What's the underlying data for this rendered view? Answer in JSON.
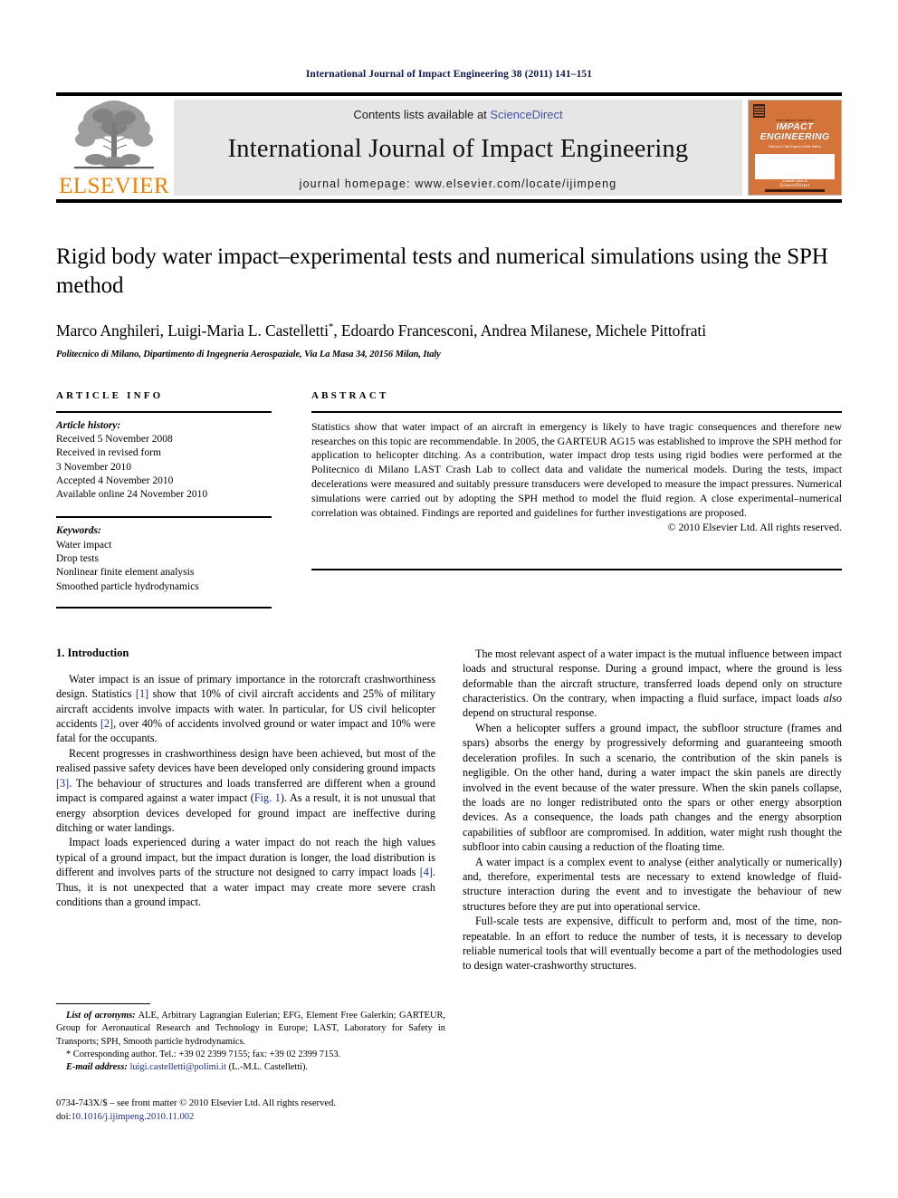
{
  "running_head": "International Journal of Impact Engineering 38 (2011) 141–151",
  "masthead": {
    "publisher_name": "ELSEVIER",
    "contents_prefix": "Contents lists available at ",
    "sciencedirect": "ScienceDirect",
    "journal_title": "International Journal of Impact Engineering",
    "homepage": "journal homepage: www.elsevier.com/locate/ijimpeng",
    "cover": {
      "small_top": "International Journal of",
      "title_line1": "IMPACT",
      "title_line2": "ENGINEERING",
      "editors": "Editors-in-Chief\nEugenio Oñate Ibáñez",
      "bottom_small": "available online at",
      "bottom_brand": "ScienceDirect"
    },
    "accent_orange": "#ef8200",
    "link_blue": "#4156a6",
    "banner_gray": "#e6e6e6"
  },
  "article": {
    "title": "Rigid body water impact–experimental tests and numerical simulations using the SPH method",
    "authors": "Marco Anghileri, Luigi-Maria L. Castelletti",
    "authors_star": "*",
    "authors_rest": ", Edoardo Francesconi, Andrea Milanese, Michele Pittofrati",
    "affiliation": "Politecnico di Milano, Dipartimento di Ingegneria Aerospaziale, Via La Masa 34, 20156 Milan, Italy"
  },
  "info": {
    "label": "ARTICLE INFO",
    "history_head": "Article history:",
    "history_lines": [
      "Received 5 November 2008",
      "Received in revised form",
      "3 November 2010",
      "Accepted 4 November 2010",
      "Available online 24 November 2010"
    ],
    "keywords_head": "Keywords:",
    "keywords": [
      "Water impact",
      "Drop tests",
      "Nonlinear finite element analysis",
      "Smoothed particle hydrodynamics"
    ]
  },
  "abstract": {
    "label": "ABSTRACT",
    "text": "Statistics show that water impact of an aircraft in emergency is likely to have tragic consequences and therefore new researches on this topic are recommendable. In 2005, the GARTEUR AG15 was established to improve the SPH method for application to helicopter ditching. As a contribution, water impact drop tests using rigid bodies were performed at the Politecnico di Milano LAST Crash Lab to collect data and validate the numerical models. During the tests, impact decelerations were measured and suitably pressure transducers were developed to measure the impact pressures. Numerical simulations were carried out by adopting the SPH method to model the fluid region. A close experimental–numerical correlation was obtained. Findings are reported and guidelines for further investigations are proposed.",
    "copyright": "© 2010 Elsevier Ltd. All rights reserved."
  },
  "body": {
    "section_number_title": "1. Introduction",
    "left_paragraphs": [
      {
        "parts": [
          {
            "t": "Water impact is an issue of primary importance in the rotorcraft crashworthiness design. Statistics "
          },
          {
            "t": "[1]",
            "k": "ref"
          },
          {
            "t": " show that 10% of civil aircraft accidents and 25% of military aircraft accidents involve impacts with water. In particular, for US civil helicopter accidents "
          },
          {
            "t": "[2]",
            "k": "ref"
          },
          {
            "t": ", over 40% of accidents involved ground or water impact and 10% were fatal for the occupants."
          }
        ]
      },
      {
        "parts": [
          {
            "t": "Recent progresses in crashworthiness design have been achieved, but most of the realised passive safety devices have been developed only considering ground impacts "
          },
          {
            "t": "[3]",
            "k": "ref"
          },
          {
            "t": ". The behaviour of structures and loads transferred are different when a ground impact is compared against a water impact ("
          },
          {
            "t": "Fig. 1",
            "k": "ref"
          },
          {
            "t": "). As a result, it is not unusual that energy absorption devices developed for ground impact are ineffective during ditching or water landings."
          }
        ]
      },
      {
        "parts": [
          {
            "t": "Impact loads experienced during a water impact do not reach the high values typical of a ground impact, but the impact duration is longer, the load distribution is different and involves parts of the structure not designed to carry impact loads "
          },
          {
            "t": "[4]",
            "k": "ref"
          },
          {
            "t": ". Thus, it is not unexpected that a water impact may create more severe crash conditions than a ground impact."
          }
        ]
      }
    ],
    "right_paragraphs": [
      {
        "parts": [
          {
            "t": "The most relevant aspect of a water impact is the mutual influence between impact loads and structural response. During a ground impact, where the ground is less deformable than the aircraft structure, transferred loads depend only on structure characteristics. On the contrary, when impacting a fluid surface, impact loads "
          },
          {
            "t": "also",
            "k": "ital"
          },
          {
            "t": " depend on structural response."
          }
        ]
      },
      {
        "parts": [
          {
            "t": "When a helicopter suffers a ground impact, the subfloor structure (frames and spars) absorbs the energy by progressively deforming and guaranteeing smooth deceleration profiles. In such a scenario, the contribution of the skin panels is negligible. On the other hand, during a water impact the skin panels are directly involved in the event because of the water pressure. When the skin panels collapse, the loads are no longer redistributed onto the spars or other energy absorption devices. As a consequence, the loads path changes and the energy absorption capabilities of subfloor are compromised. In addition, water might rush thought the subfloor into cabin causing a reduction of the floating time."
          }
        ]
      },
      {
        "parts": [
          {
            "t": "A water impact is a complex event to analyse (either analytically or numerically) and, therefore, experimental tests are necessary to extend knowledge of fluid-structure interaction during the event and to investigate the behaviour of new structures before they are put into operational service."
          }
        ]
      },
      {
        "parts": [
          {
            "t": "Full-scale tests are expensive, difficult to perform and, most of the time, non-repeatable. In an effort to reduce the number of tests, it is necessary to develop reliable numerical tools that will eventually become a part of the methodologies used to design water-crashworthy structures."
          }
        ]
      }
    ]
  },
  "footnotes": {
    "acronyms_label": "List of acronyms:",
    "acronyms_text": " ALE, Arbitrary Lagrangian Eulerian; EFG, Element Free Galerkin; GARTEUR, Group for Aeronautical Research and Technology in Europe; LAST, Laboratory for Safety in Transports; SPH, Smooth particle hydrodynamics.",
    "corresponding": "* Corresponding author. Tel.: +39 02 2399 7155; fax: +39 02 2399 7153.",
    "email_label": "E-mail address:",
    "email": "luigi.castelletti@polimi.it",
    "email_suffix": " (L.-M.L. Castelletti)."
  },
  "imprint": {
    "line1": "0734-743X/$ – see front matter © 2010 Elsevier Ltd. All rights reserved.",
    "doi_label": "doi:",
    "doi": "10.1016/j.ijimpeng.2010.11.002"
  }
}
